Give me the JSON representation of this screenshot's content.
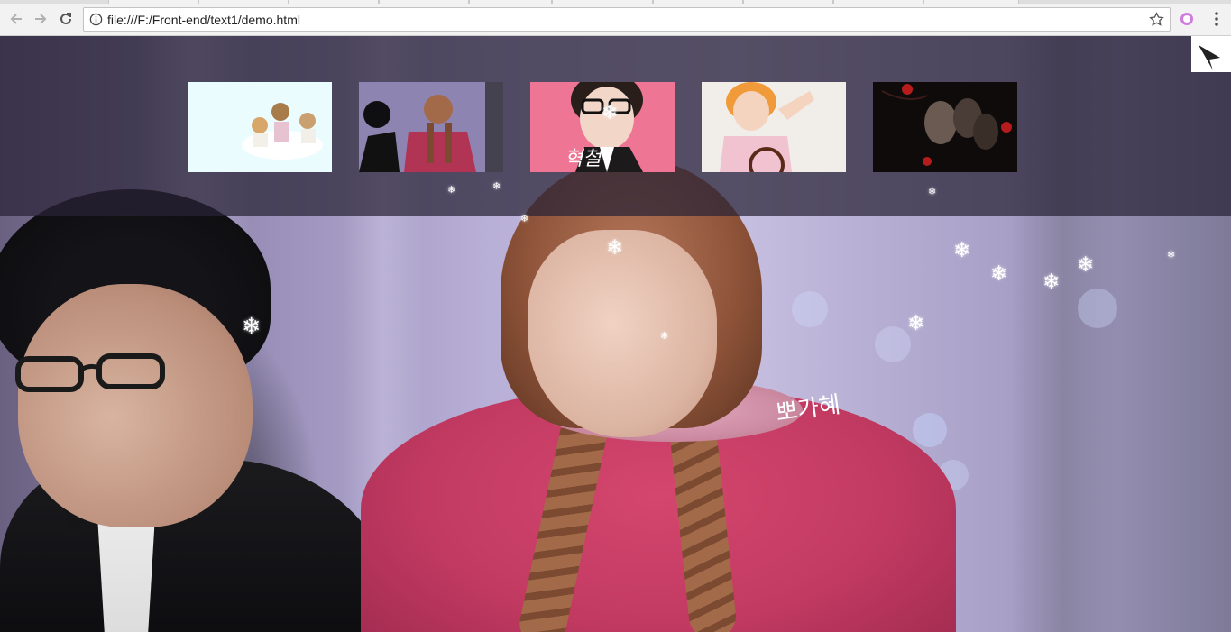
{
  "browser": {
    "url": "file:///F:/Front-end/text1/demo.html"
  },
  "page": {
    "thumbnails": [
      {
        "name": "thumbnail-1",
        "colors": [
          "#e9fbfc",
          "#f5e6d6"
        ]
      },
      {
        "name": "thumbnail-2",
        "colors": [
          "#6f6890",
          "#b23454"
        ]
      },
      {
        "name": "thumbnail-3",
        "colors": [
          "#ee7593",
          "#1d1a1c"
        ]
      },
      {
        "name": "thumbnail-4",
        "colors": [
          "#f1ede9",
          "#f09a3a"
        ]
      },
      {
        "name": "thumbnail-5",
        "colors": [
          "#0f0b0a",
          "#b61c1c"
        ]
      }
    ],
    "background_text": "뽀가혜",
    "snowflake_glyph": "❄"
  },
  "colors": {
    "overlay": "#282236",
    "accent_pink": "#c23a62"
  }
}
